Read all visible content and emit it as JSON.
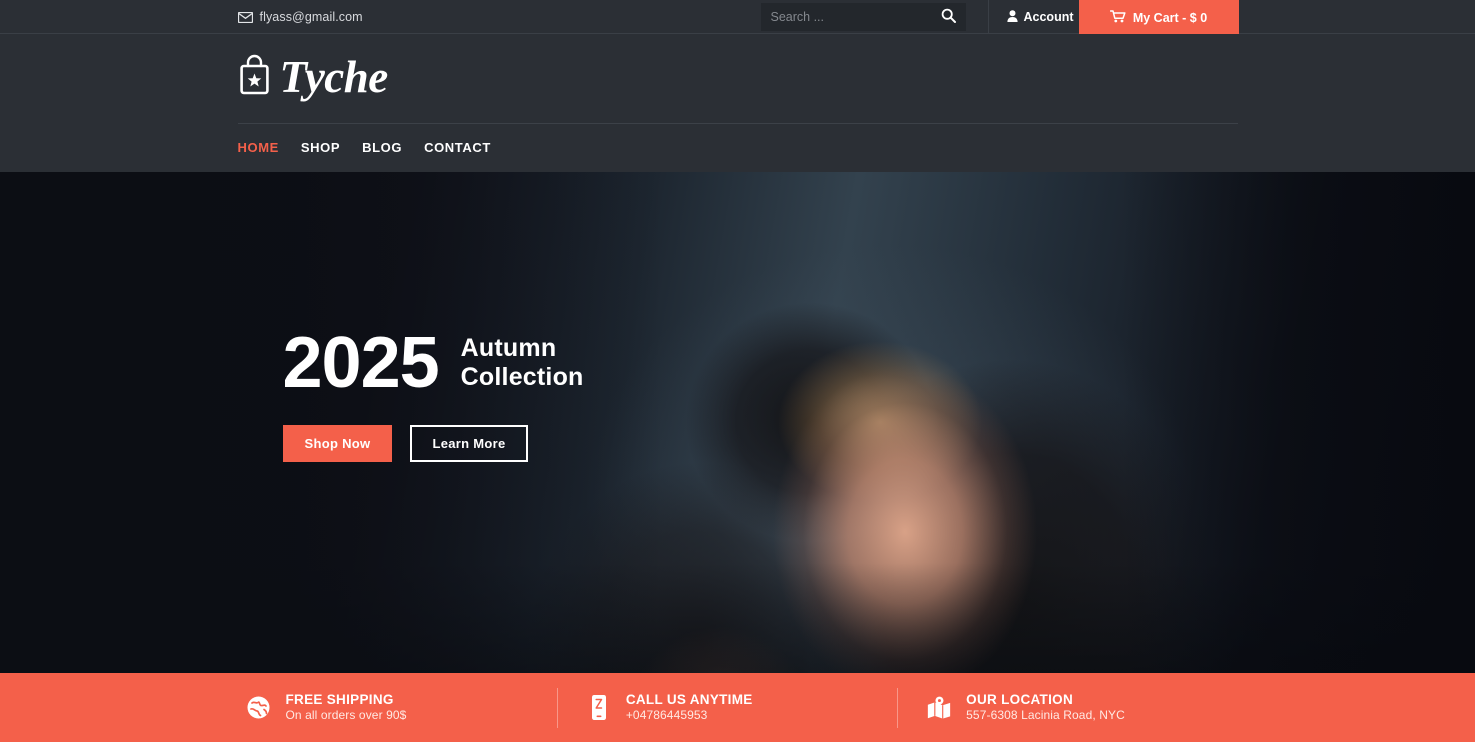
{
  "brand": {
    "name": "Tyche",
    "accent_color": "#f4604a",
    "dark_color": "#2b2f35",
    "logo_icon": "shopping-bag-star-icon"
  },
  "topbar": {
    "email": "flyass@gmail.com",
    "email_icon": "envelope-icon",
    "search": {
      "placeholder": "Search ...",
      "value": "",
      "icon": "search-icon"
    },
    "account": {
      "label": "Account",
      "icon": "user-icon"
    },
    "cart": {
      "label": "My Cart - $ 0",
      "icon": "cart-icon"
    }
  },
  "nav": {
    "items": [
      {
        "label": "HOME",
        "active": true
      },
      {
        "label": "SHOP",
        "active": false
      },
      {
        "label": "BLOG",
        "active": false
      },
      {
        "label": "CONTACT",
        "active": false
      }
    ]
  },
  "hero": {
    "year": "2025",
    "subtitle_line1": "Autumn",
    "subtitle_line2": "Collection",
    "primary_button": "Shop Now",
    "secondary_button": "Learn More"
  },
  "infobar": {
    "items": [
      {
        "icon": "globe-icon",
        "title": "FREE SHIPPING",
        "subtitle": "On all orders over 90$"
      },
      {
        "icon": "mobile-phone-icon",
        "title": "CALL US ANYTIME",
        "subtitle": "+04786445953"
      },
      {
        "icon": "map-marker-icon",
        "title": "OUR LOCATION",
        "subtitle": "557-6308 Lacinia Road, NYC"
      }
    ]
  }
}
